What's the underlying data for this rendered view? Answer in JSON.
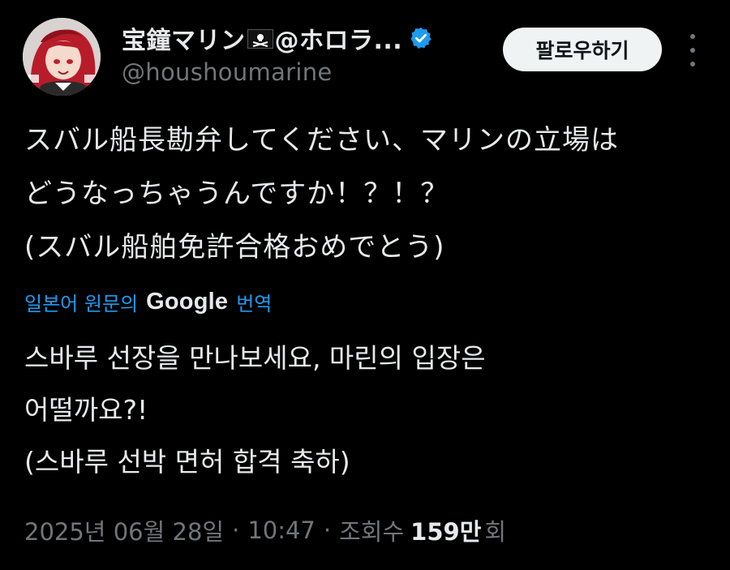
{
  "user": {
    "display_name": "宝鐘マリン",
    "display_name_suffix": "@ホロラ...",
    "handle": "@houshoumarine",
    "avatar_icon": "avatar-image",
    "flag_icon": "pirate-flag-icon",
    "verified_icon": "verified-badge-icon"
  },
  "actions": {
    "follow_label": "팔로우하기",
    "more_icon": "more-vertical-icon"
  },
  "tweet": {
    "lines": [
      "スバル船長勘弁してください、マリンの立場は",
      "どうなっちゃうんですか！？！？",
      "(スバル船舶免許合格おめでとう)"
    ]
  },
  "translation": {
    "prefix": "일본어 원문의",
    "provider": "Google",
    "suffix": "번역",
    "lines": [
      "스바루 선장을 만나보세요, 마린의 입장은",
      "어떨까요?!",
      "(스바루 선박 면허 합격 축하)"
    ]
  },
  "meta": {
    "date": "2025년 06월 28일",
    "separator": "·",
    "time": "10:47",
    "views_label": "조회수",
    "views_count": "159만",
    "views_suffix": "회"
  },
  "colors": {
    "background": "#000000",
    "text": "#e7e9ea",
    "muted": "#71767b",
    "link": "#1d9bf0",
    "verified": "#1d9bf0",
    "button_bg": "#eff3f4"
  }
}
